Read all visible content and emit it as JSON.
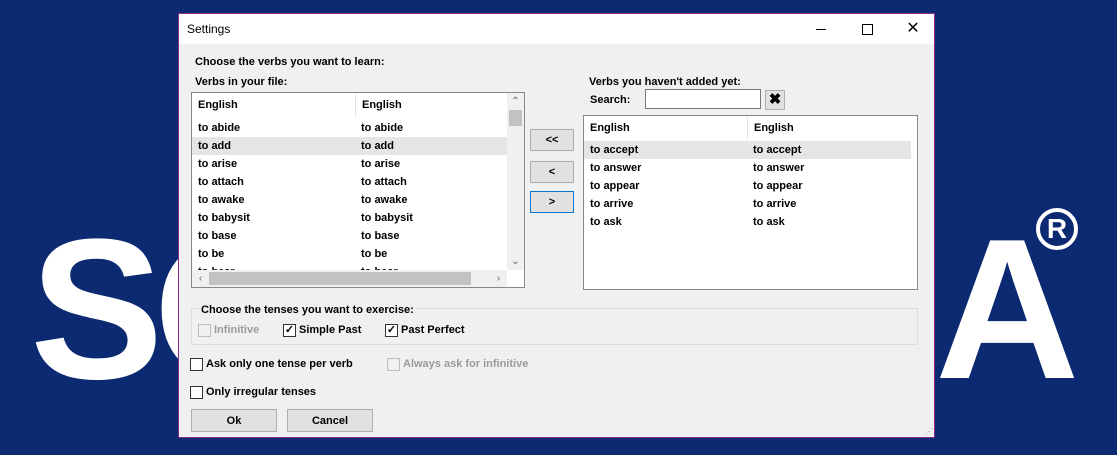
{
  "background": {
    "logo_left": "SO",
    "logo_right": "A",
    "registered": "R",
    "watermark": "SOFTPEDIA"
  },
  "window": {
    "title": "Settings"
  },
  "labels": {
    "choose_verbs": "Choose the verbs you want to learn:",
    "verbs_in_file": "Verbs in your file:",
    "verbs_not_added": "Verbs you haven't added yet:",
    "search": "Search:",
    "choose_tenses": "Choose the tenses you want to exercise:"
  },
  "left_list": {
    "headers": [
      "English",
      "English"
    ],
    "rows": [
      [
        "to abide",
        "to abide"
      ],
      [
        "to add",
        "to add"
      ],
      [
        "to arise",
        "to arise"
      ],
      [
        "to attach",
        "to attach"
      ],
      [
        "to awake",
        "to awake"
      ],
      [
        "to babysit",
        "to babysit"
      ],
      [
        "to base",
        "to base"
      ],
      [
        "to be",
        "to be"
      ],
      [
        "to bear",
        "to bear"
      ]
    ]
  },
  "right_list": {
    "headers": [
      "English",
      "English"
    ],
    "rows": [
      [
        "to accept",
        "to accept"
      ],
      [
        "to answer",
        "to answer"
      ],
      [
        "to appear",
        "to appear"
      ],
      [
        "to arrive",
        "to arrive"
      ],
      [
        "to ask",
        "to ask"
      ]
    ]
  },
  "move_buttons": {
    "all_left": "<<",
    "left": "<",
    "right": ">"
  },
  "search": {
    "value": "",
    "clear_icon": "✖"
  },
  "tenses": {
    "infinitive": "Infinitive",
    "simple_past": "Simple Past",
    "past_perfect": "Past Perfect"
  },
  "options": {
    "one_tense": "Ask only one tense per verb",
    "always_infinitive": "Always ask for infinitive",
    "only_irregular": "Only irregular tenses"
  },
  "buttons": {
    "ok": "Ok",
    "cancel": "Cancel"
  }
}
